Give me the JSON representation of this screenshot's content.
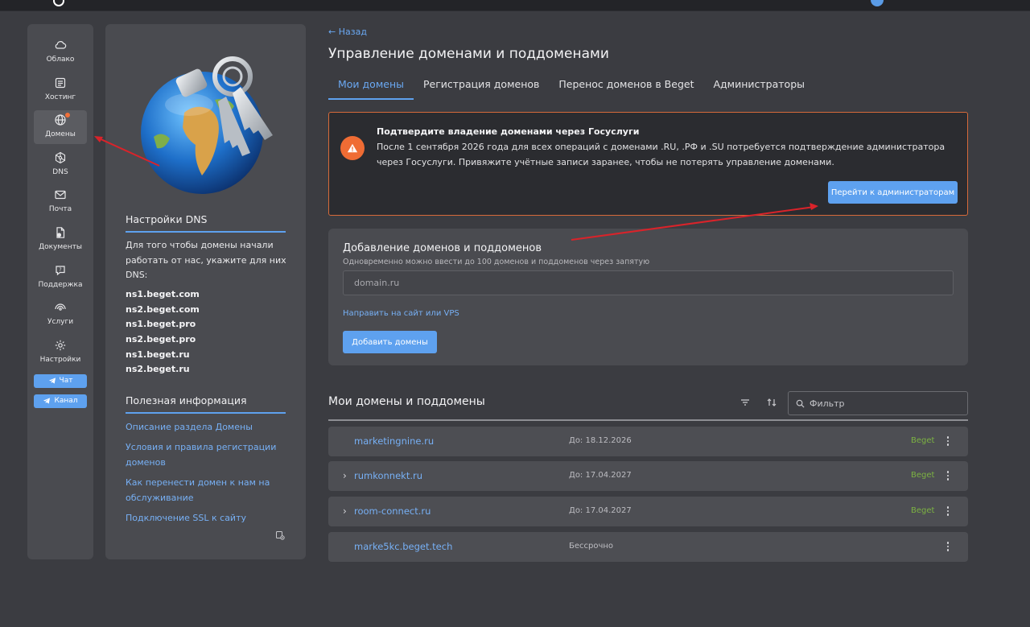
{
  "colors": {
    "accent": "#5ea1ef",
    "link": "#77b0f5",
    "warning": "#ef6c34",
    "registrar": "#7cb342",
    "annotation_arrow": "#d9232a"
  },
  "nav": {
    "items": [
      {
        "label": "Облако",
        "icon": "cloud-icon"
      },
      {
        "label": "Хостинг",
        "icon": "server-icon"
      },
      {
        "label": "Домены",
        "icon": "globe-icon",
        "active": true,
        "badge": true
      },
      {
        "label": "DNS",
        "icon": "network-icon"
      },
      {
        "label": "Почта",
        "icon": "mail-icon"
      },
      {
        "label": "Документы",
        "icon": "document-icon"
      },
      {
        "label": "Поддержка",
        "icon": "support-icon"
      },
      {
        "label": "Услуги",
        "icon": "services-icon"
      },
      {
        "label": "Настройки",
        "icon": "gear-icon"
      }
    ],
    "chat_label": "Чат",
    "channel_label": "Канал"
  },
  "info": {
    "dns_title": "Настройки DNS",
    "dns_description": "Для того чтобы домены начали работать от нас, укажите для них DNS:",
    "nameservers": [
      "ns1.beget.com",
      "ns2.beget.com",
      "ns1.beget.pro",
      "ns2.beget.pro",
      "ns1.beget.ru",
      "ns2.beget.ru"
    ],
    "useful_title": "Полезная информация",
    "links": [
      "Описание раздела Домены",
      "Условия и правила регистрации доменов",
      "Как перенести домен к нам на обслуживание",
      "Подключение SSL к сайту"
    ]
  },
  "main": {
    "back_label": "← Назад",
    "title": "Управление доменами и поддоменами",
    "tabs": [
      "Мои домены",
      "Регистрация доменов",
      "Перенос доменов в Beget",
      "Администраторы"
    ],
    "alert": {
      "title": "Подтвердите владение доменами через Госуслуги",
      "text": "После 1 сентября 2026 года для всех операций с доменами .RU, .РФ и .SU потребуется подтверждение администратора через Госуслуги. Привяжите учётные записи заранее, чтобы не потерять управление доменами.",
      "button": "Перейти к администраторам"
    },
    "add": {
      "title": "Добавление доменов и поддоменов",
      "subtitle": "Одновременно можно ввести до 100 доменов и поддоменов через запятую",
      "placeholder": "domain.ru",
      "redirect_link": "Направить на сайт или VPS",
      "button": "Добавить домены"
    },
    "list": {
      "title": "Мои домены и поддомены",
      "filter_placeholder": "Фильтр",
      "rows": [
        {
          "domain": "marketingnine.ru",
          "expires": "До: 18.12.2026",
          "registrar": "Beget",
          "expandable": false
        },
        {
          "domain": "rumkonnekt.ru",
          "expires": "До: 17.04.2027",
          "registrar": "Beget",
          "expandable": true
        },
        {
          "domain": "room-connect.ru",
          "expires": "До: 17.04.2027",
          "registrar": "Beget",
          "expandable": true
        },
        {
          "domain": "marke5kc.beget.tech",
          "expires": "Бессрочно",
          "registrar": "",
          "expandable": false
        }
      ]
    }
  }
}
